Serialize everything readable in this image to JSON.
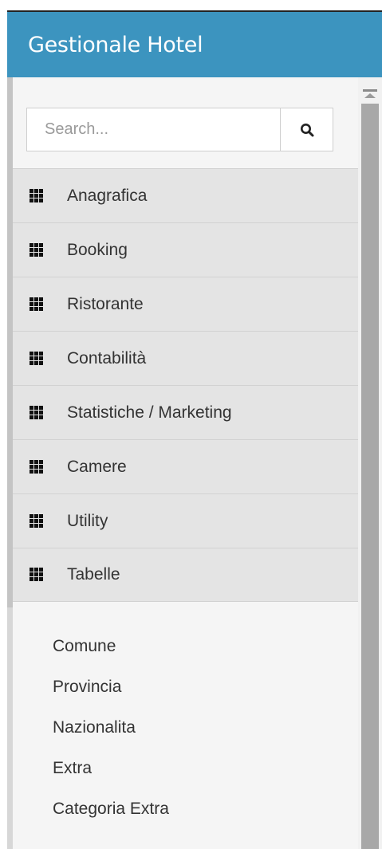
{
  "header": {
    "title": "Gestionale Hotel"
  },
  "search": {
    "placeholder": "Search...",
    "value": ""
  },
  "menu": {
    "items": [
      {
        "label": "Anagrafica",
        "icon": "grid-icon"
      },
      {
        "label": "Booking",
        "icon": "grid-icon"
      },
      {
        "label": "Ristorante",
        "icon": "grid-icon"
      },
      {
        "label": "Contabilità",
        "icon": "grid-icon"
      },
      {
        "label": "Statistiche / Marketing",
        "icon": "grid-icon"
      },
      {
        "label": "Camere",
        "icon": "grid-icon"
      },
      {
        "label": "Utility",
        "icon": "grid-icon"
      },
      {
        "label": "Tabelle",
        "icon": "grid-icon"
      }
    ]
  },
  "submenu": {
    "items": [
      {
        "label": "Comune"
      },
      {
        "label": "Provincia"
      },
      {
        "label": "Nazionalita"
      },
      {
        "label": "Extra"
      },
      {
        "label": "Categoria Extra"
      }
    ]
  },
  "colors": {
    "header_bg": "#3c94bf",
    "menu_bg": "#e4e4e4",
    "sidebar_bg": "#f5f5f5"
  }
}
